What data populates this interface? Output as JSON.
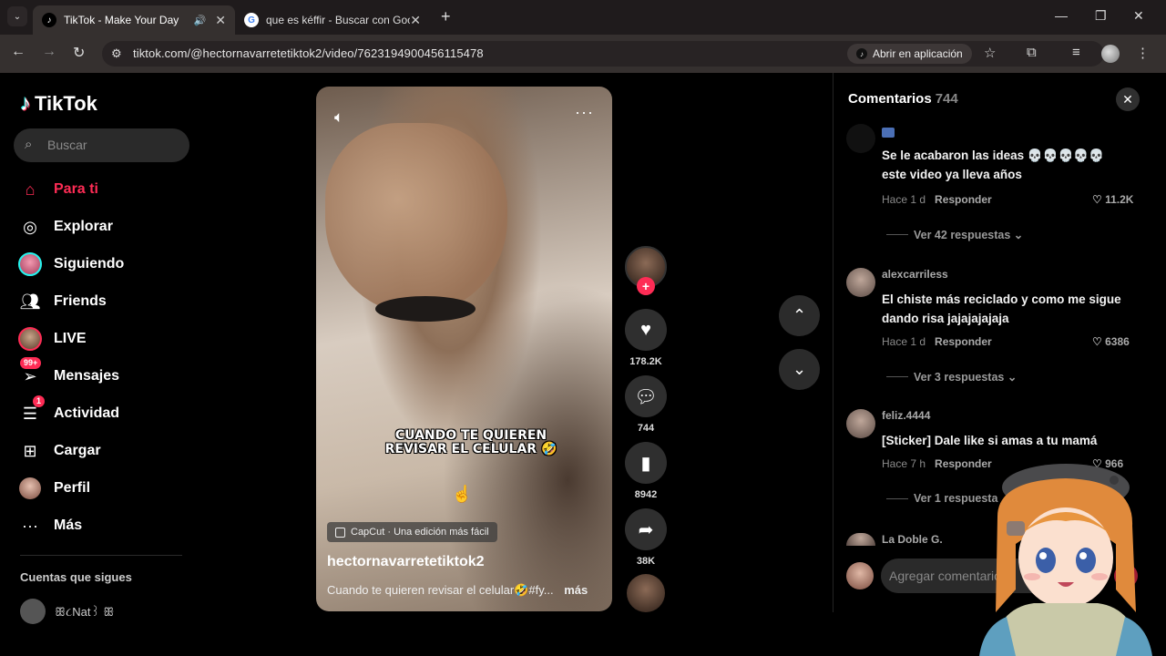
{
  "browser": {
    "tabs": [
      {
        "title": "TikTok - Make Your Day",
        "active": true
      },
      {
        "title": "que es kéffir - Buscar con Goog",
        "active": false
      }
    ],
    "url": "tiktok.com/@hectornavarretetiktok2/video/7623194900456115478",
    "open_app_label": "Abrir en aplicación"
  },
  "sidebar": {
    "logo": "TikTok",
    "search_placeholder": "Buscar",
    "items": [
      {
        "label": "Para ti",
        "icon": "home-icon"
      },
      {
        "label": "Explorar",
        "icon": "compass-icon"
      },
      {
        "label": "Siguiendo",
        "icon": "avatar-icon"
      },
      {
        "label": "Friends",
        "icon": "friends-icon"
      },
      {
        "label": "LIVE",
        "icon": "live-avatar-icon"
      },
      {
        "label": "Mensajes",
        "icon": "messages-icon",
        "badge": "99+"
      },
      {
        "label": "Actividad",
        "icon": "activity-icon",
        "badge": "1"
      },
      {
        "label": "Cargar",
        "icon": "upload-icon"
      },
      {
        "label": "Perfil",
        "icon": "profile-avatar-icon"
      },
      {
        "label": "Más",
        "icon": "more-icon"
      }
    ],
    "following_title": "Cuentas que sigues",
    "following_first": "ꕥ૮Nat꒱ ꕥ"
  },
  "video": {
    "overlay_text": "CUANDO TE QUIEREN REVISAR EL CELULAR 🤣",
    "capcut_label": "CapCut · Una edición más fácil",
    "author": "hectornavarretetiktok2",
    "description": "Cuando te quieren revisar el celular🤣#fy...",
    "more_label": "más"
  },
  "actions": {
    "likes": "178.2K",
    "comments": "744",
    "saves": "8942",
    "shares": "38K"
  },
  "comments": {
    "title": "Comentarios",
    "count": "744",
    "input_placeholder": "Agregar comentario...",
    "items": [
      {
        "user": "",
        "text": "Se le acabaron las ideas 💀💀💀💀💀 este video ya lleva años",
        "time": "Hace 1 d",
        "reply": "Responder",
        "likes": "11.2K",
        "replies": "Ver 42 respuestas"
      },
      {
        "user": "alexcarriless",
        "text": "El chiste más reciclado y como me sigue dando risa jajajajajaja",
        "time": "Hace 1 d",
        "reply": "Responder",
        "likes": "6386",
        "replies": "Ver 3 respuestas"
      },
      {
        "user": "feliz.4444",
        "text": "[Sticker] Dale like si amas a tu mamá",
        "time": "Hace 7 h",
        "reply": "Responder",
        "likes": "966",
        "replies": "Ver 1 respuesta"
      },
      {
        "user": "La Doble G.",
        "text": "",
        "time": "",
        "reply": "",
        "likes": "",
        "replies": ""
      }
    ]
  }
}
